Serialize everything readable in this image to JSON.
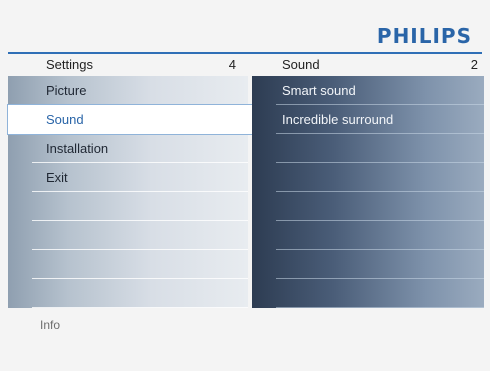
{
  "brand": {
    "logo_text": "PHILIPS",
    "color": "#2a65a8"
  },
  "left_menu": {
    "title": "Settings",
    "count": "4",
    "items": [
      {
        "label": "Picture",
        "selected": false
      },
      {
        "label": "Sound",
        "selected": true
      },
      {
        "label": "Installation",
        "selected": false
      },
      {
        "label": "Exit",
        "selected": false
      },
      {
        "label": "",
        "selected": false
      },
      {
        "label": "",
        "selected": false
      },
      {
        "label": "",
        "selected": false
      },
      {
        "label": "",
        "selected": false
      }
    ]
  },
  "right_menu": {
    "title": "Sound",
    "count": "2",
    "items": [
      {
        "label": "Smart sound"
      },
      {
        "label": "Incredible surround"
      },
      {
        "label": ""
      },
      {
        "label": ""
      },
      {
        "label": ""
      },
      {
        "label": ""
      },
      {
        "label": ""
      },
      {
        "label": ""
      }
    ]
  },
  "footer": {
    "info_label": "Info"
  }
}
